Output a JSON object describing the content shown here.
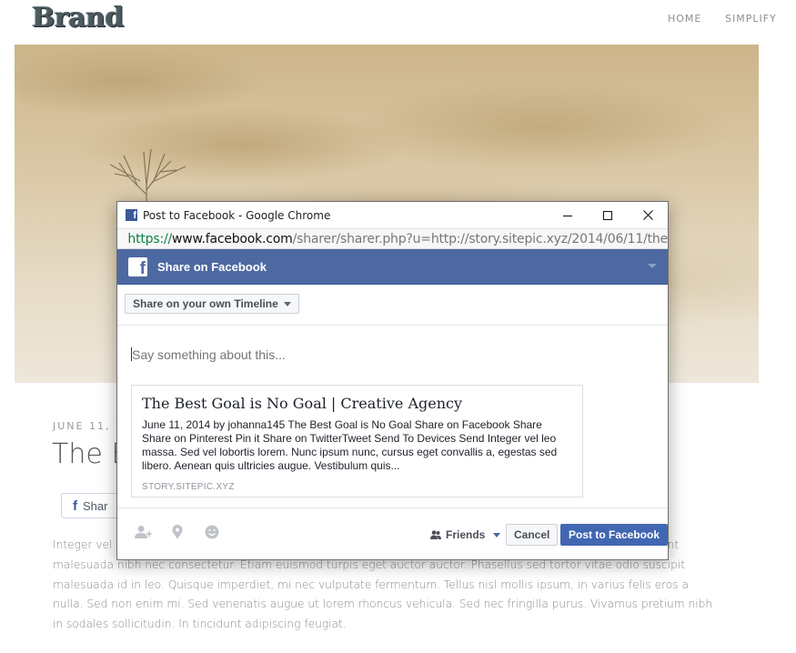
{
  "site": {
    "brand": "Brand",
    "nav": [
      "HOME",
      "SIMPLIFY"
    ],
    "post_date": "JUNE 11, 2",
    "post_title": "The B",
    "share_button_label": "Shar",
    "body_text": "Integer vel l                                                                                                              n quis ultricies augue. Vestibulum quis nisl tristique, interdum velit non, rutrum arcu. Nulla tincidunt malesuada nibh nec consectetur. Etiam euismod turpis eget auctor auctor. Phasellus sed tortor vitae odio suscipit malesuada id in leo. Quisque imperdiet, mi nec vulputate fermentum. Tellus nisl mollis ipsum, in varius felis eros a nulla. Sed non enim mi. Sed venenatis augue ut lorem rhoncus vehicula. Sed nec fringilla purus. Vivamus pretium nibh in sodales sollicitudin. In tincidunt adipiscing feugiat."
  },
  "popup": {
    "window_title": "Post to Facebook - Google Chrome",
    "url": {
      "scheme": "https://",
      "host": "www.facebook.com",
      "path": "/sharer/sharer.php?u=http://story.sitepic.xyz/2014/06/11/the"
    },
    "header_title": "Share on Facebook",
    "timeline_select": "Share on your own Timeline",
    "composer_placeholder": "Say something about this...",
    "preview": {
      "title": "The Best Goal is No Goal | Creative Agency",
      "description": "June 11, 2014  by johanna145 The Best Goal is No Goal Share on Facebook Share Share on Pinterest Pin it Share on TwitterTweet Send To Devices Send Integer vel leo massa. Sed vel lobortis lorem. Nunc ipsum nunc, cursus eget convallis a, egestas sed libero. Aenean quis ultricies augue. Vestibulum quis...",
      "domain": "STORY.SITEPIC.XYZ"
    },
    "audience": "Friends",
    "cancel_label": "Cancel",
    "post_label": "Post to Facebook"
  }
}
